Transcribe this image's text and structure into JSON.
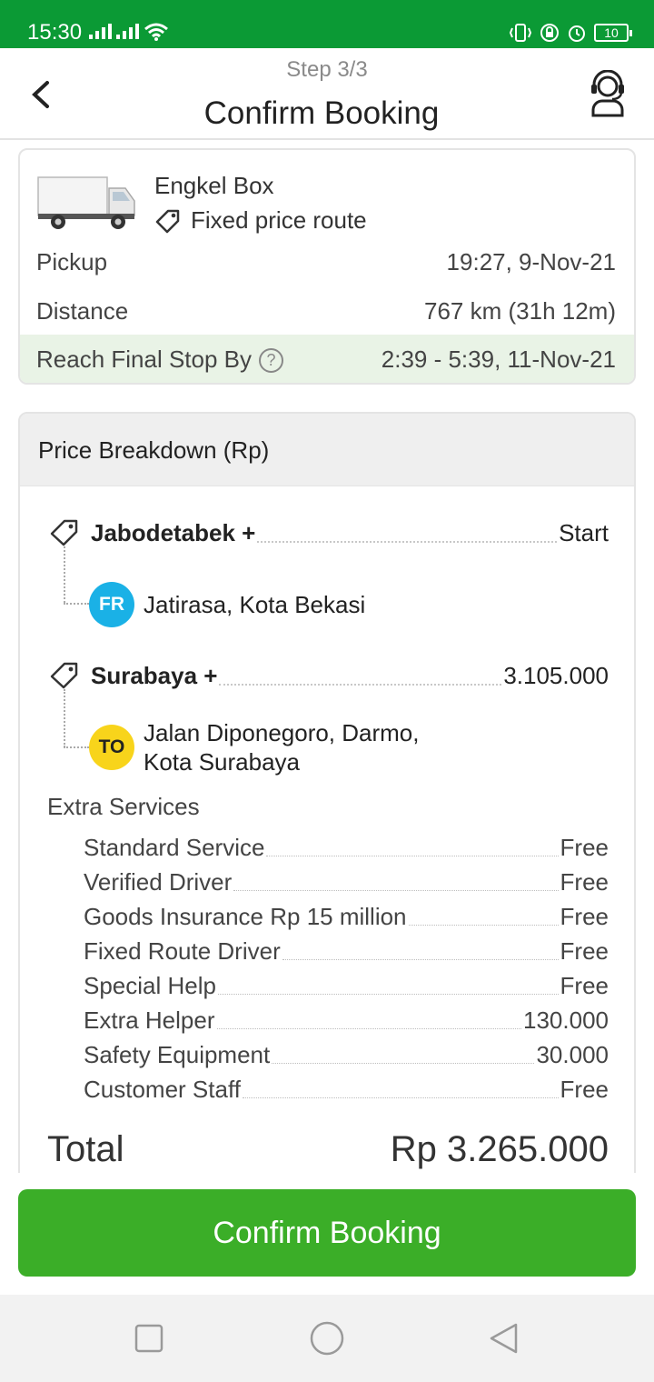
{
  "status_bar": {
    "time": "15:30",
    "battery": "10"
  },
  "header": {
    "step": "Step 3/3",
    "title": "Confirm Booking"
  },
  "vehicle": {
    "name": "Engkel Box",
    "route_type": "Fixed price route"
  },
  "trip": {
    "pickup_label": "Pickup",
    "pickup_value": "19:27, 9-Nov-21",
    "distance_label": "Distance",
    "distance_value": "767 km (31h 12m)",
    "reach_label": "Reach Final Stop By",
    "reach_value": "2:39 - 5:39, 11-Nov-21"
  },
  "price": {
    "header": "Price Breakdown (Rp)",
    "stops": [
      {
        "zone": "Jabodetabek +",
        "amount": "Start",
        "badge": "FR",
        "address": "Jatirasa, Kota Bekasi"
      },
      {
        "zone": "Surabaya +",
        "amount": "3.105.000",
        "badge": "TO",
        "address_line1": "Jalan Diponegoro, Darmo,",
        "address_line2": "Kota Surabaya"
      }
    ],
    "extra_title": "Extra Services",
    "services": [
      {
        "name": "Standard Service",
        "value": "Free"
      },
      {
        "name": "Verified Driver",
        "value": "Free"
      },
      {
        "name": "Goods Insurance Rp 15 million",
        "value": "Free"
      },
      {
        "name": "Fixed Route Driver",
        "value": "Free"
      },
      {
        "name": "Special Help",
        "value": "Free"
      },
      {
        "name": "Extra Helper",
        "value": "130.000"
      },
      {
        "name": "Safety Equipment",
        "value": "30.000"
      },
      {
        "name": "Customer Staff",
        "value": "Free"
      }
    ],
    "total_label": "Total",
    "total_value": "Rp 3.265.000"
  },
  "cta": {
    "label": "Confirm Booking"
  },
  "colors": {
    "status_bar": "#0b9a35",
    "primary": "#3bae28",
    "from_badge": "#1ab1e6",
    "to_badge": "#f8d41b",
    "highlight_row": "#e9f3e6"
  }
}
